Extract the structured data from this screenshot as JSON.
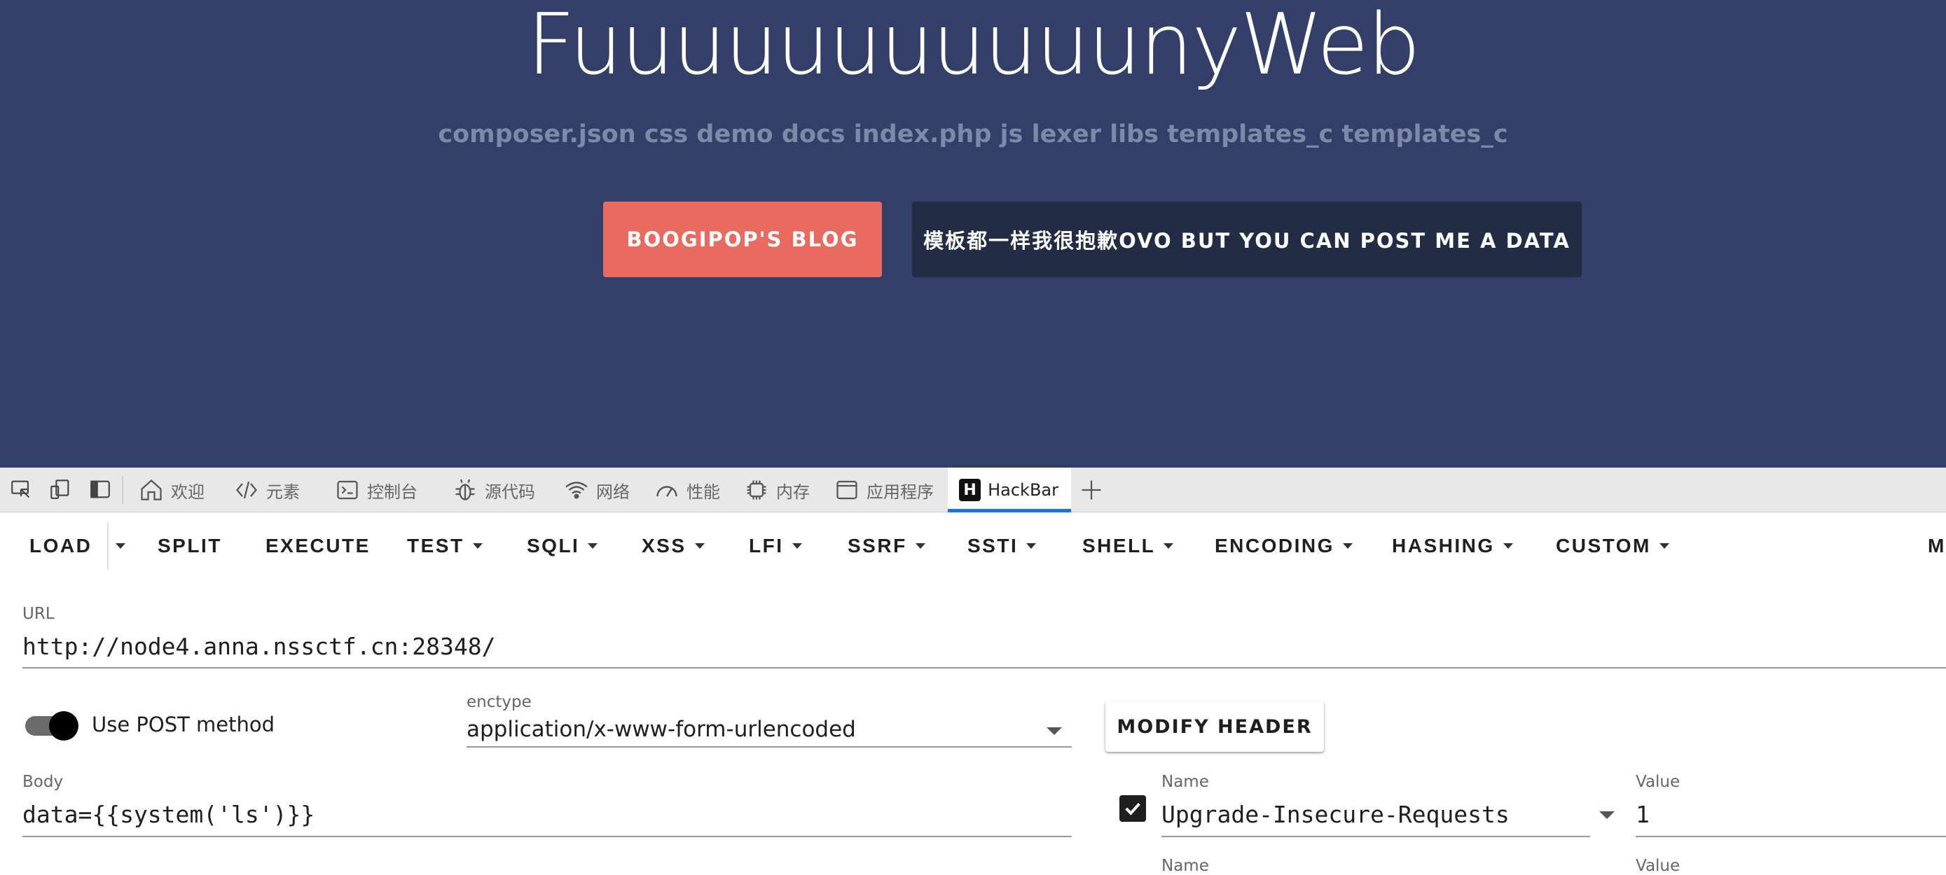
{
  "hero": {
    "title": "FuuuuuuuuuuunyWeb",
    "subtitle": "composer.json css demo docs index.php js lexer libs templates_c templates_c",
    "blog_button": "BOOGIPOP'S BLOG",
    "post_button": "模板都一样我很抱歉OVO BUT YOU CAN POST ME A DATA",
    "colors": {
      "background": "#333f68",
      "blog_button": "#e96a5e",
      "post_button": "#232c45"
    }
  },
  "devtools": {
    "toolbar_icons": [
      "inspect-element-icon",
      "device-toolbar-icon",
      "dock-sidebar-icon"
    ],
    "tabs": [
      {
        "label": "欢迎",
        "icon": "home-icon"
      },
      {
        "label": "元素",
        "icon": "code-brackets-icon"
      },
      {
        "label": "控制台",
        "icon": "console-icon"
      },
      {
        "label": "源代码",
        "icon": "bug-icon"
      },
      {
        "label": "网络",
        "icon": "wifi-icon"
      },
      {
        "label": "性能",
        "icon": "gauge-icon"
      },
      {
        "label": "内存",
        "icon": "chip-icon"
      },
      {
        "label": "应用程序",
        "icon": "window-icon"
      },
      {
        "label": "HackBar",
        "icon": "hackbar-logo-icon",
        "logo_letter": "H",
        "active": true
      }
    ],
    "add_tab_icon": "plus-icon",
    "active_tab_color": "#1a73e8"
  },
  "hackbar": {
    "toolbar": {
      "load": "LOAD",
      "split": "SPLIT",
      "execute": "EXECUTE",
      "test": "TEST",
      "sqli": "SQLI",
      "xss": "XSS",
      "lfi": "LFI",
      "ssrf": "SSRF",
      "ssti": "SSTI",
      "shell": "SHELL",
      "encoding": "ENCODING",
      "hashing": "HASHING",
      "custom": "CUSTOM",
      "overflow": "M"
    },
    "url_label": "URL",
    "url_value": "http://node4.anna.nssctf.cn:28348/",
    "post_toggle": {
      "label": "Use POST method",
      "on": true
    },
    "enctype_label": "enctype",
    "enctype_value": "application/x-www-form-urlencoded",
    "modify_header_button": "MODIFY HEADER",
    "body_label": "Body",
    "body_value": "data={{system('ls')}}",
    "headers": [
      {
        "checked": true,
        "name_label": "Name",
        "name": "Upgrade-Insecure-Requests",
        "value_label": "Value",
        "value": "1"
      },
      {
        "name_label": "Name",
        "value_label": "Value"
      }
    ]
  }
}
